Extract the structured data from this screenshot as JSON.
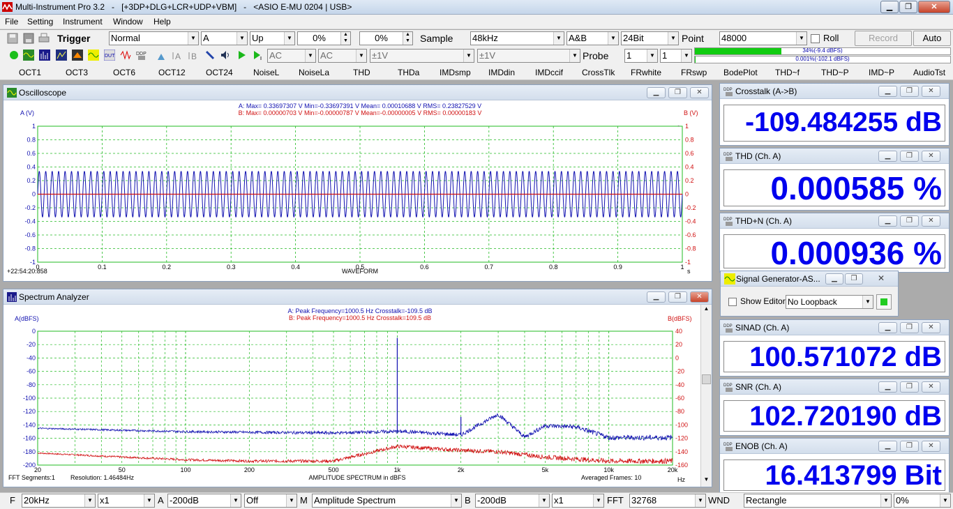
{
  "titlebar": {
    "app": "Multi-Instrument Pro 3.2",
    "tags": "[+3DP+DLG+LCR+UDP+VBM]",
    "device": "<ASIO E-MU 0204 | USB>"
  },
  "menu": [
    "File",
    "Setting",
    "Instrument",
    "Window",
    "Help"
  ],
  "toolbar1": {
    "trigger_label": "Trigger",
    "trigger_mode": "Normal",
    "trigger_channel": "A",
    "trigger_edge": "Up",
    "trigger_level": "0%",
    "trigger_delay": "0%",
    "sample_label": "Sample",
    "sample_rate": "48kHz",
    "channels": "A&B",
    "bit_depth": "24Bit",
    "point_label": "Point",
    "points": "48000",
    "roll_label": "Roll",
    "record_label": "Record",
    "auto_label": "Auto"
  },
  "toolbar2": {
    "coupling_a": "AC",
    "coupling_b": "AC",
    "range_a": "±1V",
    "range_b": "±1V",
    "probe_label": "Probe",
    "probe_a": "1",
    "probe_b": "1",
    "level_a_text": "34%(-9.4 dBFS)",
    "level_b_text": "0.001%(-102.1 dBFS)",
    "level_a_fraction": 0.34,
    "level_b_fraction": 1e-05
  },
  "funcbar": [
    "OCT1",
    "OCT3",
    "OCT6",
    "OCT12",
    "OCT24",
    "NoiseL",
    "NoiseLa",
    "THD",
    "THDa",
    "IMDsmp",
    "IMDdin",
    "IMDccif",
    "CrossTlk",
    "FRwhite",
    "FRswp",
    "BodePlot",
    "THD~f",
    "THD~P",
    "IMD~P",
    "AudioTst"
  ],
  "oscilloscope": {
    "title": "Oscilloscope",
    "stats_a": "A: Max= 0.33697307 V  Min=-0.33697391 V  Mean= 0.00010688 V  RMS= 0.23827529 V",
    "stats_b": "B: Max= 0.00000703 V  Min=-0.00000787 V  Mean=-0.00000005 V  RMS= 0.00000183 V",
    "ylabel_a": "A (V)",
    "ylabel_b": "B (V)",
    "xlabel": "WAVEFORM",
    "xunit": "s",
    "timestamp": "+22:54:20:858",
    "logo": "Mi"
  },
  "spectrum": {
    "title": "Spectrum Analyzer",
    "stats_a": "A: Peak Frequency=1000.5 Hz  Crosstalk=-109.5 dB",
    "stats_b": "B: Peak Frequency=1000.5 Hz  Crosstalk=109.5 dB",
    "ylabel_a": "A(dBFS)",
    "ylabel_b": "B(dBFS)",
    "xlabel": "AMPLITUDE SPECTRUM in dBFS",
    "xunit": "Hz",
    "fft_segments": "FFT Segments:1",
    "resolution": "Resolution: 1.46484Hz",
    "averaged": "Averaged Frames: 10",
    "logo": "Mi"
  },
  "meters": [
    {
      "title": "Crosstalk (A->B)",
      "value": "-109.484255 dB"
    },
    {
      "title": "THD (Ch. A)",
      "value": "0.000585 %"
    },
    {
      "title": "THD+N (Ch. A)",
      "value": "0.000936 %"
    }
  ],
  "meters2": [
    {
      "title": "SINAD (Ch. A)",
      "value": "100.571072 dB"
    },
    {
      "title": "SNR (Ch. A)",
      "value": "102.720190 dB"
    },
    {
      "title": "ENOB (Ch. A)",
      "value": "16.413799 Bit"
    }
  ],
  "siggen": {
    "title": "Signal Generator-AS...",
    "show_editor": "Show Editor",
    "loopback": "No Loopback"
  },
  "statusbar": {
    "f_label": "F",
    "f_range": "20kHz",
    "f_zoom": "x1",
    "a_label": "A",
    "a_min": "-200dB",
    "a_mode": "Off",
    "m_label": "M",
    "m_mode": "Amplitude Spectrum",
    "b_label": "B",
    "b_min": "-200dB",
    "b_zoom": "x1",
    "fft_label": "FFT",
    "fft_size": "32768",
    "wnd_label": "WND",
    "window": "Rectangle",
    "overlap": "0%"
  },
  "colors": {
    "ch_a": "#1010b0",
    "ch_b": "#d01010",
    "grid": "#22bb22",
    "meter_text": "#0000ee"
  },
  "chart_data": [
    {
      "type": "line",
      "title": "",
      "xlabel": "WAVEFORM",
      "ylabel": "A (V)",
      "y2label": "B (V)",
      "xlim": [
        0,
        1
      ],
      "ylim": [
        -1,
        1
      ],
      "y2lim": [
        -1,
        1
      ],
      "x_ticks": [
        "0",
        "0.1",
        "0.2",
        "0.3",
        "0.4",
        "0.5",
        "0.6",
        "0.7",
        "0.8",
        "0.9",
        "1"
      ],
      "y_ticks": [
        "1",
        "0.8",
        "0.6",
        "0.4",
        "0.2",
        "0",
        "-0.2",
        "-0.4",
        "-0.6",
        "-0.8",
        "-1"
      ],
      "grid": true,
      "series": [
        {
          "name": "A",
          "amplitude": 0.337,
          "cycles_shown": 100,
          "color": "#1010b0"
        },
        {
          "name": "B",
          "amplitude": 7.9e-06,
          "color": "#d01010"
        }
      ]
    },
    {
      "type": "line",
      "title": "",
      "xlabel": "AMPLITUDE SPECTRUM in dBFS",
      "ylabel": "A(dBFS)",
      "y2label": "B(dBFS)",
      "xscale": "log",
      "xlim": [
        20,
        20000
      ],
      "ylim": [
        -200,
        0
      ],
      "y2lim": [
        -160,
        40
      ],
      "x_ticks": [
        "20",
        "50",
        "100",
        "200",
        "500",
        "1k",
        "2k",
        "5k",
        "10k",
        "20k"
      ],
      "y_ticks": [
        "0",
        "-20",
        "-40",
        "-60",
        "-80",
        "-100",
        "-120",
        "-140",
        "-160",
        "-180",
        "-200"
      ],
      "y2_ticks": [
        "40",
        "20",
        "0",
        "-20",
        "-40",
        "-60",
        "-80",
        "-100",
        "-120",
        "-140",
        "-160"
      ],
      "grid": true,
      "series": [
        {
          "name": "A",
          "color": "#1010b0",
          "points": [
            [
              20,
              -145
            ],
            [
              50,
              -148
            ],
            [
              100,
              -150
            ],
            [
              200,
              -151
            ],
            [
              500,
              -152
            ],
            [
              900,
              -150
            ],
            [
              1000.5,
              -10
            ],
            [
              1100,
              -150
            ],
            [
              2000,
              -155
            ],
            [
              2000,
              -128
            ],
            [
              3000,
              -124
            ],
            [
              4000,
              -158
            ],
            [
              5000,
              -141
            ],
            [
              7000,
              -143
            ],
            [
              10000,
              -159
            ],
            [
              20000,
              -159
            ]
          ]
        },
        {
          "name": "B",
          "color": "#d01010",
          "points": [
            [
              20,
              -182
            ],
            [
              50,
              -188
            ],
            [
              100,
              -192
            ],
            [
              200,
              -194
            ],
            [
              500,
              -194
            ],
            [
              1000.5,
              -172
            ],
            [
              2000,
              -178
            ],
            [
              3000,
              -180
            ],
            [
              5000,
              -188
            ],
            [
              10000,
              -194
            ],
            [
              20000,
              -194
            ]
          ]
        }
      ]
    }
  ]
}
